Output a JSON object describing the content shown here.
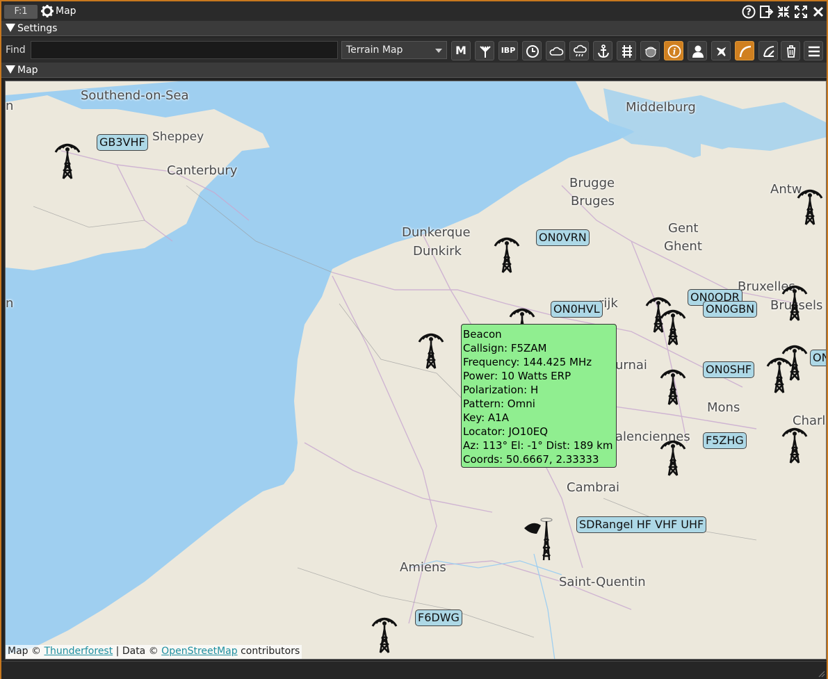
{
  "window": {
    "tab_number": "F:1",
    "title": "Map"
  },
  "settings_section": {
    "label": "Settings"
  },
  "map_section": {
    "label": "Map"
  },
  "find": {
    "label": "Find",
    "value": ""
  },
  "map_type": {
    "selected": "Terrain Map"
  },
  "toolbar": {
    "m_label": "M",
    "ibp_label": "IBP"
  },
  "map": {
    "cities": [
      "Southend-on-Sea",
      "Sheppey",
      "Canterbury",
      "Middelburg",
      "Brugge",
      "Bruges",
      "Antw",
      "Gent",
      "Ghent",
      "Dunkerque",
      "Dunkirk",
      "Bruxelles",
      "Brussels",
      "rijk",
      "urnai",
      "Mons",
      "Charle",
      "alenciennes",
      "Cambrai",
      "Amiens",
      "Saint-Quentin",
      "n",
      "n"
    ],
    "markers": [
      "GB3VHF",
      "ON0VRN",
      "ON0HVL",
      "ON0ODR",
      "ON0GBN",
      "ON0SHF",
      "ON",
      "F5ZHG",
      "SDRangel HF VHF UHF",
      "F6DWG"
    ],
    "popup": {
      "title": "Beacon",
      "callsign": "Callsign: F5ZAM",
      "frequency": "Frequency: 144.425 MHz",
      "power": "Power: 10 Watts ERP",
      "polarization": "Polarization: H",
      "pattern": "Pattern: Omni",
      "key": "Key: A1A",
      "locator": "Locator: JO10EQ",
      "azimuth": "Az: 113° El: -1° Dist: 189 km",
      "coords": "Coords: 50.6667, 2.33333"
    },
    "attribution": {
      "prefix": "Map © ",
      "tile_provider": "Thunderforest",
      "middle": " | Data © ",
      "data_provider": "OpenStreetMap",
      "suffix": " contributors"
    }
  },
  "colors": {
    "sea": "#9fcff0",
    "land": "#ece8dc",
    "accent": "#d08020",
    "tag_bg": "#add8e6",
    "popup_bg": "#90ee90"
  }
}
